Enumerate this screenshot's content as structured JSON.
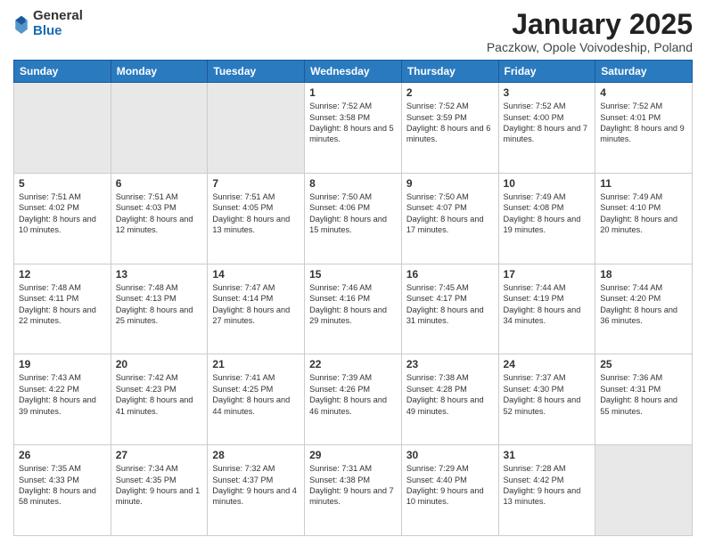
{
  "logo": {
    "general": "General",
    "blue": "Blue"
  },
  "title": "January 2025",
  "subtitle": "Paczkow, Opole Voivodeship, Poland",
  "headers": [
    "Sunday",
    "Monday",
    "Tuesday",
    "Wednesday",
    "Thursday",
    "Friday",
    "Saturday"
  ],
  "weeks": [
    [
      {
        "day": "",
        "info": ""
      },
      {
        "day": "",
        "info": ""
      },
      {
        "day": "",
        "info": ""
      },
      {
        "day": "1",
        "info": "Sunrise: 7:52 AM\nSunset: 3:58 PM\nDaylight: 8 hours and 5 minutes."
      },
      {
        "day": "2",
        "info": "Sunrise: 7:52 AM\nSunset: 3:59 PM\nDaylight: 8 hours and 6 minutes."
      },
      {
        "day": "3",
        "info": "Sunrise: 7:52 AM\nSunset: 4:00 PM\nDaylight: 8 hours and 7 minutes."
      },
      {
        "day": "4",
        "info": "Sunrise: 7:52 AM\nSunset: 4:01 PM\nDaylight: 8 hours and 9 minutes."
      }
    ],
    [
      {
        "day": "5",
        "info": "Sunrise: 7:51 AM\nSunset: 4:02 PM\nDaylight: 8 hours and 10 minutes."
      },
      {
        "day": "6",
        "info": "Sunrise: 7:51 AM\nSunset: 4:03 PM\nDaylight: 8 hours and 12 minutes."
      },
      {
        "day": "7",
        "info": "Sunrise: 7:51 AM\nSunset: 4:05 PM\nDaylight: 8 hours and 13 minutes."
      },
      {
        "day": "8",
        "info": "Sunrise: 7:50 AM\nSunset: 4:06 PM\nDaylight: 8 hours and 15 minutes."
      },
      {
        "day": "9",
        "info": "Sunrise: 7:50 AM\nSunset: 4:07 PM\nDaylight: 8 hours and 17 minutes."
      },
      {
        "day": "10",
        "info": "Sunrise: 7:49 AM\nSunset: 4:08 PM\nDaylight: 8 hours and 19 minutes."
      },
      {
        "day": "11",
        "info": "Sunrise: 7:49 AM\nSunset: 4:10 PM\nDaylight: 8 hours and 20 minutes."
      }
    ],
    [
      {
        "day": "12",
        "info": "Sunrise: 7:48 AM\nSunset: 4:11 PM\nDaylight: 8 hours and 22 minutes."
      },
      {
        "day": "13",
        "info": "Sunrise: 7:48 AM\nSunset: 4:13 PM\nDaylight: 8 hours and 25 minutes."
      },
      {
        "day": "14",
        "info": "Sunrise: 7:47 AM\nSunset: 4:14 PM\nDaylight: 8 hours and 27 minutes."
      },
      {
        "day": "15",
        "info": "Sunrise: 7:46 AM\nSunset: 4:16 PM\nDaylight: 8 hours and 29 minutes."
      },
      {
        "day": "16",
        "info": "Sunrise: 7:45 AM\nSunset: 4:17 PM\nDaylight: 8 hours and 31 minutes."
      },
      {
        "day": "17",
        "info": "Sunrise: 7:44 AM\nSunset: 4:19 PM\nDaylight: 8 hours and 34 minutes."
      },
      {
        "day": "18",
        "info": "Sunrise: 7:44 AM\nSunset: 4:20 PM\nDaylight: 8 hours and 36 minutes."
      }
    ],
    [
      {
        "day": "19",
        "info": "Sunrise: 7:43 AM\nSunset: 4:22 PM\nDaylight: 8 hours and 39 minutes."
      },
      {
        "day": "20",
        "info": "Sunrise: 7:42 AM\nSunset: 4:23 PM\nDaylight: 8 hours and 41 minutes."
      },
      {
        "day": "21",
        "info": "Sunrise: 7:41 AM\nSunset: 4:25 PM\nDaylight: 8 hours and 44 minutes."
      },
      {
        "day": "22",
        "info": "Sunrise: 7:39 AM\nSunset: 4:26 PM\nDaylight: 8 hours and 46 minutes."
      },
      {
        "day": "23",
        "info": "Sunrise: 7:38 AM\nSunset: 4:28 PM\nDaylight: 8 hours and 49 minutes."
      },
      {
        "day": "24",
        "info": "Sunrise: 7:37 AM\nSunset: 4:30 PM\nDaylight: 8 hours and 52 minutes."
      },
      {
        "day": "25",
        "info": "Sunrise: 7:36 AM\nSunset: 4:31 PM\nDaylight: 8 hours and 55 minutes."
      }
    ],
    [
      {
        "day": "26",
        "info": "Sunrise: 7:35 AM\nSunset: 4:33 PM\nDaylight: 8 hours and 58 minutes."
      },
      {
        "day": "27",
        "info": "Sunrise: 7:34 AM\nSunset: 4:35 PM\nDaylight: 9 hours and 1 minute."
      },
      {
        "day": "28",
        "info": "Sunrise: 7:32 AM\nSunset: 4:37 PM\nDaylight: 9 hours and 4 minutes."
      },
      {
        "day": "29",
        "info": "Sunrise: 7:31 AM\nSunset: 4:38 PM\nDaylight: 9 hours and 7 minutes."
      },
      {
        "day": "30",
        "info": "Sunrise: 7:29 AM\nSunset: 4:40 PM\nDaylight: 9 hours and 10 minutes."
      },
      {
        "day": "31",
        "info": "Sunrise: 7:28 AM\nSunset: 4:42 PM\nDaylight: 9 hours and 13 minutes."
      },
      {
        "day": "",
        "info": ""
      }
    ]
  ]
}
